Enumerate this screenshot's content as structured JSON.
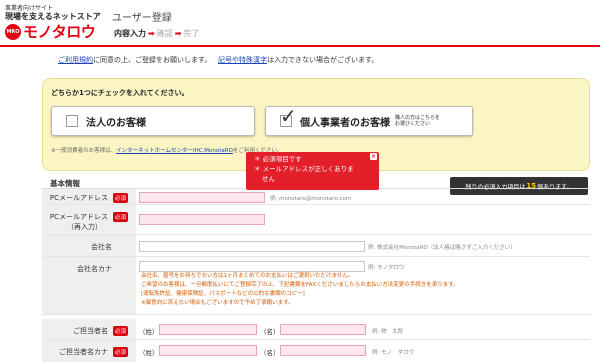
{
  "header": {
    "tag": "事業者向けサイト",
    "tagline": "現場を支えるネットストア",
    "logo_mark": "MRO",
    "logo_text": "モノタロウ",
    "page_title": "ユーザー登録",
    "steps": [
      "内容入力",
      "確認",
      "完了"
    ],
    "arrow": "➡"
  },
  "notice": {
    "link1": "ご利用規約",
    "text1": "に同意の上、ご登録をお願いします。",
    "link2": "記号や特殊漢字",
    "text2": "は入力できない場合がございます。"
  },
  "selection": {
    "title": "どちらか1つにチェックを入れてください。",
    "corporate_label": "法人のお客様",
    "individual_label": "個人事業者のお客様",
    "individual_sub": "職人の方はこちらを\nお選びください",
    "footer_text1": "※一般消費者のお客様は、",
    "footer_link": "インターネットホームセンターIHC.MonotaRO",
    "footer_text2": "をご利用ください。"
  },
  "section": {
    "title": "基本情報"
  },
  "remaining": {
    "prefix": "残りの必須入力項目は",
    "count": "15",
    "suffix": "個あります。"
  },
  "error": {
    "line1": "＊ 必須項目です",
    "line2": "＊ メールアドレスが正しくありま",
    "line3": "せん",
    "close": "×"
  },
  "form": {
    "required_badge": "必須",
    "pc_email_label": "PCメールアドレス",
    "pc_email_hint": "例: monotaro@monotaro.com",
    "pc_email_confirm_label": "PCメールアドレス",
    "pc_email_confirm_sub": "（再入力）",
    "company_label": "会社名",
    "company_hint": "例: 株式会社MonotaRO（法人格は略さずご入力ください）",
    "company_kana_label": "会社名カナ",
    "company_kana_hint": "例: モノタロウ",
    "company_kana_notes": [
      "会社名、屋号をお持ちでない方は1ヶ月まとめてのお支払いはご選択いただけません。",
      "ご希望のお客様は、一旦都度払いにてご登録完了の上、下記書類をFAXくださいましたらお支払い方法変更の手続きを承ります。",
      "[運転免許証、健康保険証、パスポートなどの公的な書類のコピー]",
      "※御意向に添えない場合もございますので予め了承願います。"
    ],
    "contact_label": "ご担当者名",
    "contact_hint": "例: 物　太郎",
    "contact_kana_label": "ご担当者名カナ",
    "contact_kana_hint": "例: モノ　タロウ",
    "last_name": "（姓）",
    "first_name": "（名）"
  },
  "colors": {
    "brand": "#e60012",
    "link": "#1a44b8",
    "highlight": "#fbf5c3",
    "error_field": "#fde6ec"
  }
}
